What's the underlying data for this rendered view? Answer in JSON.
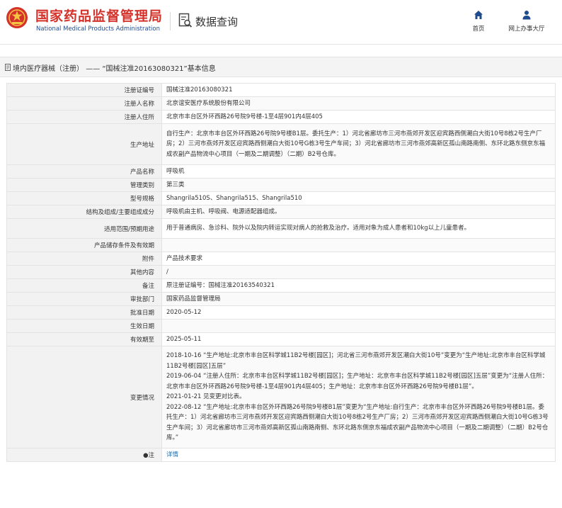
{
  "header": {
    "site_title": "国家药品监督管理局",
    "site_subtitle": "National Medical Products Administration",
    "query_label": "数据查询",
    "nav": [
      {
        "label": "首页",
        "icon": "home-icon"
      },
      {
        "label": "网上办事大厅",
        "icon": "user-icon"
      }
    ]
  },
  "breadcrumb": {
    "section": "境内医疗器械（注册）",
    "separator": "——",
    "title": "“国械注准20163080321”基本信息"
  },
  "colors": {
    "brand_red": "#d4332b",
    "brand_blue": "#1f4b8e",
    "link_blue": "#1a6fb5",
    "label_bg": "#f2f2f2"
  },
  "rows": [
    {
      "label": "注册证编号",
      "value": "国械注准20163080321",
      "h": 19
    },
    {
      "label": "注册人名称",
      "value": "北京谊安医疗系统股份有限公司",
      "h": 19
    },
    {
      "label": "注册人住所",
      "value": "北京市丰台区外环西路26号院9号楼-1至4层901内4层405",
      "h": 19
    },
    {
      "label": "生产地址",
      "value": "自行生产：北京市丰台区外环西路26号院9号楼B1层。委托生产：1）河北省廊坊市三河市燕郊开发区迎宾路西侧潮白大街10号8栋2号生产厂房；2）三河市燕郊开发区迎宾路西侧潮白大街10号G栋3号生产车间；3）河北省廊坊市三河市燕郊高新区孤山南路南侧、东环北路东侧京东福成农副产品物流中心项目（一期及二期调整）（二期）B2号仓库。",
      "h": 58
    },
    {
      "label": "产品名称",
      "value": "呼吸机",
      "h": 19
    },
    {
      "label": "管理类别",
      "value": "第三类",
      "h": 19
    },
    {
      "label": "型号规格",
      "value": "Shangrila510S、Shangrila515、Shangrila510",
      "h": 19
    },
    {
      "label": "结构及组成/主要组成成分",
      "value": "呼吸机由主机、呼吸阀、电源适配器组成。",
      "h": 19
    },
    {
      "label": "适用范围/预期用途",
      "value": "用于普通病房、急诊科、院外以及院内转运实现对病人的抢救及治疗。适用对象为成人患者和10kg以上儿童患者。",
      "h": 28
    },
    {
      "label": "产品储存条件及有效期",
      "value": "",
      "h": 19
    },
    {
      "label": "附件",
      "value": "产品技术要求",
      "h": 19
    },
    {
      "label": "其他内容",
      "value": "/",
      "h": 19
    },
    {
      "label": "备注",
      "value": "原注册证编号：国械注准20163540321",
      "h": 19
    },
    {
      "label": "审批部门",
      "value": "国家药品监督管理局",
      "h": 19
    },
    {
      "label": "批准日期",
      "value": "2020-05-12",
      "h": 19
    },
    {
      "label": "生效日期",
      "value": "",
      "h": 19
    },
    {
      "label": "有效期至",
      "value": "2025-05-11",
      "h": 19
    },
    {
      "label": "变更情况",
      "value": "2018-10-16 “生产地址:北京市丰台区科学城11B2号楼[园区]；河北省三河市燕郊开发区潮白大街10号”变更为“生产地址:北京市丰台区科学城11B2号楼[园区]五层”\n2019-06-04 “注册人住所：北京市丰台区科学城11B2号楼[园区]；生产地址：北京市丰台区科学城11B2号楼[园区]五层”变更为“注册人住所：北京市丰台区外环西路26号院9号楼-1至4层901内4层405；生产地址：北京市丰台区外环西路26号院9号楼B1层”。\n2021-01-21 见变更对比表。\n2022-08-12 “生产地址:北京市丰台区外环西路26号院9号楼B1层”变更为“生产地址:自行生产：北京市丰台区外环西路26号院9号楼B1层。委托生产：1）河北省廊坊市三河市燕郊开发区迎宾路西侧潮白大街10号8栋2号生产厂房；2）三河市燕郊开发区迎宾路西侧潮白大街10号G栋3号生产车间；3）河北省廊坊市三河市燕郊高新区孤山南路南侧、东环北路东侧京东福成农副产品物流中心项目（一期及二期调整）（二期）B2号仓库。”",
      "h": 144
    },
    {
      "label": "●注",
      "value": "详情",
      "h": 19,
      "link": true
    }
  ]
}
